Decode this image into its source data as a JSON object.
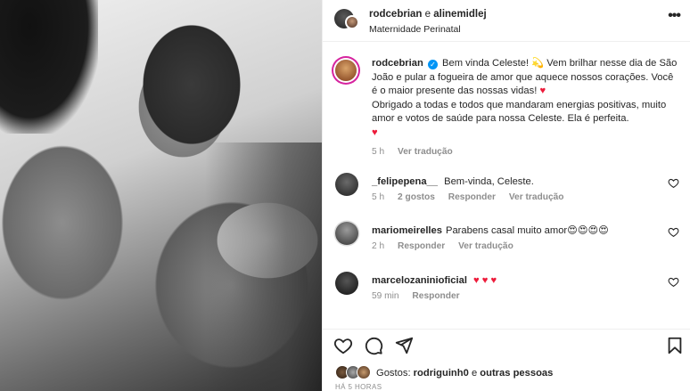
{
  "header": {
    "user1": "rodcebrian",
    "connector": "e",
    "user2": "alinemidlej",
    "location": "Maternidade Perinatal",
    "more": "•••"
  },
  "caption": {
    "user": "rodcebrian",
    "text1": "Bem vinda Celeste! 💫 Vem brilhar nesse dia de São João e pular a fogueira de amor que aquece nossos corações. Você é o maior presente das nossas vidas!",
    "heart1": "♥",
    "text2": "Obrigado a todas e todos que mandaram energias positivas, muito amor e votos de saúde para nossa Celeste. Ela é perfeita.",
    "heart2": "♥",
    "time": "5 h",
    "translate": "Ver tradução"
  },
  "comments": [
    {
      "user": "_felipepena__",
      "text": "Bem-vinda, Celeste.",
      "time": "5 h",
      "likes": "2 gostos",
      "reply": "Responder",
      "translate": "Ver tradução"
    },
    {
      "user": "mariomeirelles",
      "text": "Parabens casal muito amor😍😍😍😍",
      "time": "2 h",
      "reply": "Responder",
      "translate": "Ver tradução"
    },
    {
      "user": "marcelozaninioficial",
      "text": "♥ ♥ ♥",
      "time": "59 min",
      "reply": "Responder"
    }
  ],
  "likes": {
    "prefix": "Gostos:",
    "user": "rodriguinh0",
    "connector": "e",
    "others": "outras pessoas"
  },
  "timestamp": "HÁ 5 HORAS",
  "icons": {
    "like": "heart-outline-icon",
    "comment": "comment-bubble-icon",
    "share": "paper-plane-icon",
    "save": "bookmark-icon"
  },
  "colors": {
    "heart": "#ed1b3a",
    "verified": "#0095f6",
    "meta": "#8e8e8e",
    "story_ring": "#d6249f"
  }
}
